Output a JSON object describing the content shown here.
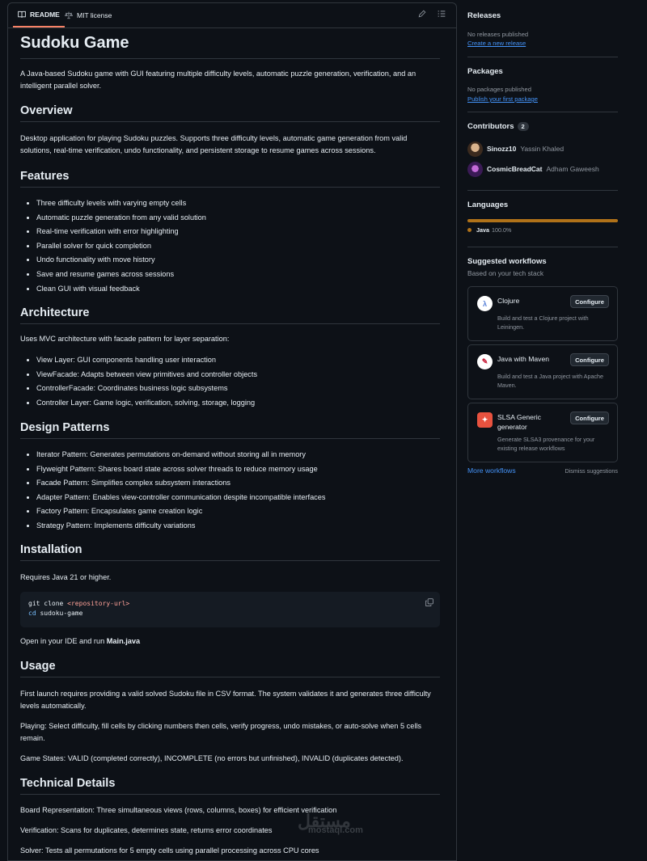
{
  "tabs": {
    "readme": "README",
    "license": "MIT license"
  },
  "readme": {
    "title": "Sudoku Game",
    "intro": "A Java-based Sudoku game with GUI featuring multiple difficulty levels, automatic puzzle generation, verification, and an intelligent parallel solver.",
    "overview": {
      "heading": "Overview",
      "text": "Desktop application for playing Sudoku puzzles. Supports three difficulty levels, automatic game generation from valid solutions, real-time verification, undo functionality, and persistent storage to resume games across sessions."
    },
    "features": {
      "heading": "Features",
      "items": [
        "Three difficulty levels with varying empty cells",
        "Automatic puzzle generation from any valid solution",
        "Real-time verification with error highlighting",
        "Parallel solver for quick completion",
        "Undo functionality with move history",
        "Save and resume games across sessions",
        "Clean GUI with visual feedback"
      ]
    },
    "architecture": {
      "heading": "Architecture",
      "text": "Uses MVC architecture with facade pattern for layer separation:",
      "items": [
        "View Layer: GUI components handling user interaction",
        "ViewFacade: Adapts between view primitives and controller objects",
        "ControllerFacade: Coordinates business logic subsystems",
        "Controller Layer: Game logic, verification, solving, storage, logging"
      ]
    },
    "patterns": {
      "heading": "Design Patterns",
      "items": [
        "Iterator Pattern: Generates permutations on-demand without storing all in memory",
        "Flyweight Pattern: Shares board state across solver threads to reduce memory usage",
        "Facade Pattern: Simplifies complex subsystem interactions",
        "Adapter Pattern: Enables view-controller communication despite incompatible interfaces",
        "Factory Pattern: Encapsulates game creation logic",
        "Strategy Pattern: Implements difficulty variations"
      ]
    },
    "installation": {
      "heading": "Installation",
      "text": "Requires Java 21 or higher.",
      "code_line1_cmd": "git clone ",
      "code_line1_arg": "<repository-url>",
      "code_line2_cmd": "cd",
      "code_line2_arg": " sudoku-game",
      "after_prefix": "Open in your IDE and run ",
      "after_file": "Main.java"
    },
    "usage": {
      "heading": "Usage",
      "p1": "First launch requires providing a valid solved Sudoku file in CSV format. The system validates it and generates three difficulty levels automatically.",
      "p2": "Playing: Select difficulty, fill cells by clicking numbers then cells, verify progress, undo mistakes, or auto-solve when 5 cells remain.",
      "p3": "Game States: VALID (completed correctly), INCOMPLETE (no errors but unfinished), INVALID (duplicates detected)."
    },
    "technical": {
      "heading": "Technical Details",
      "p1": "Board Representation: Three simultaneous views (rows, columns, boxes) for efficient verification",
      "p2": "Verification: Scans for duplicates, determines state, returns error coordinates",
      "p3": "Solver: Tests all permutations for 5 empty cells using parallel processing across CPU cores"
    }
  },
  "sidebar": {
    "releases": {
      "heading": "Releases",
      "empty": "No releases published",
      "link": "Create a new release"
    },
    "packages": {
      "heading": "Packages",
      "empty": "No packages published",
      "link": "Publish your first package"
    },
    "contributors": {
      "heading": "Contributors",
      "count": "2",
      "people": [
        {
          "login": "Sinozz10",
          "name": "Yassin Khaled"
        },
        {
          "login": "CosmicBreadCat",
          "name": "Adham Gaweesh"
        }
      ]
    },
    "languages": {
      "heading": "Languages",
      "items": [
        {
          "name": "Java",
          "percent": "100.0%",
          "color": "#b07219"
        }
      ]
    },
    "workflows": {
      "heading": "Suggested workflows",
      "subheading": "Based on your tech stack",
      "configure_label": "Configure",
      "items": [
        {
          "name": "Clojure",
          "desc": "Build and test a Clojure project with Leiningen."
        },
        {
          "name": "Java with Maven",
          "desc": "Build and test a Java project with Apache Maven."
        },
        {
          "name": "SLSA Generic generator",
          "desc": "Generate SLSA3 provenance for your existing release workflows"
        }
      ],
      "more": "More workflows",
      "dismiss": "Dismiss suggestions"
    }
  },
  "watermark": {
    "arabic": "مستقل",
    "latin": "mostaql.com"
  }
}
